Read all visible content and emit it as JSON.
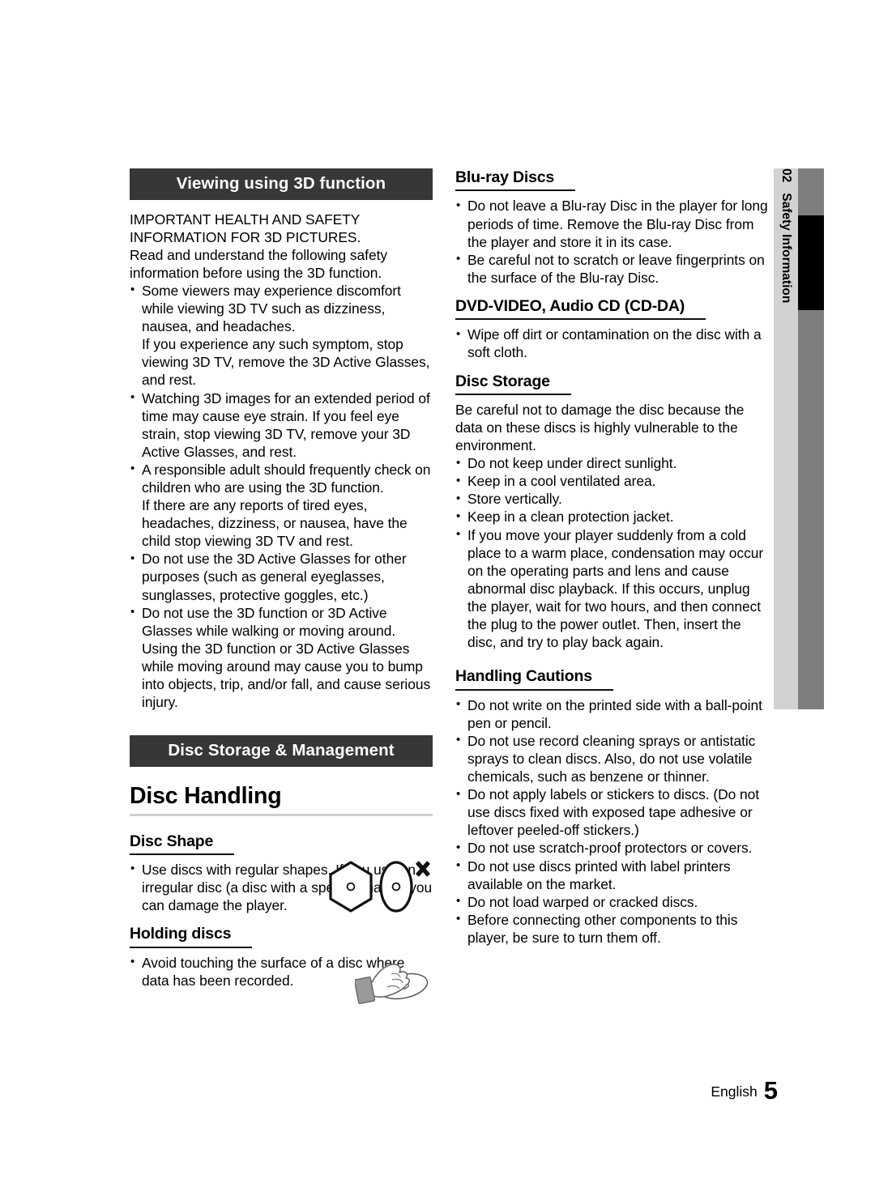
{
  "page": {
    "footer_language": "English",
    "footer_page_number": "5",
    "colors": {
      "banner_background": "#373737",
      "banner_text": "#ffffff",
      "sidetab_light": "#d2d2d2",
      "sidetab_dark": "#7e7e7e",
      "sidetab_marker": "#000000",
      "heading_rule": "#cfcfcf",
      "body_text": "#000000"
    }
  },
  "side_tab": {
    "chapter_number": "02",
    "chapter_title": "Safety Information"
  },
  "left_column": {
    "banner_3d": "Viewing using 3D function",
    "intro_line_1": "IMPORTANT HEALTH AND SAFETY INFORMATION FOR 3D PICTURES.",
    "intro_line_2": "Read and understand the following safety information before using the 3D function.",
    "bullets_3d": [
      {
        "text": "Some viewers may experience discomfort while viewing 3D TV such as dizziness, nausea, and headaches.",
        "continuation": "If you experience any such symptom, stop viewing 3D TV, remove the 3D Active Glasses, and rest."
      },
      {
        "text": "Watching 3D images for an extended period of time may cause eye strain. If you feel eye strain, stop viewing 3D TV, remove your 3D Active Glasses, and rest.",
        "continuation": ""
      },
      {
        "text": "A responsible adult should frequently check on children who are using the 3D function.",
        "continuation": "If there are any reports of tired eyes, headaches, dizziness, or nausea, have the child stop viewing 3D TV and rest."
      },
      {
        "text": "Do not use the 3D Active Glasses for other purposes (such as general eyeglasses, sunglasses, protective goggles, etc.)",
        "continuation": ""
      },
      {
        "text": "Do not use the 3D function or 3D Active Glasses while walking or moving around. Using the 3D function or 3D Active Glasses while moving around may cause you to bump into objects, trip, and/or fall, and cause serious injury.",
        "continuation": ""
      }
    ],
    "banner_storage": "Disc Storage & Management",
    "heading_disc_handling": "Disc Handling",
    "subheading_disc_shape": "Disc Shape",
    "disc_shape_bullet": "Use discs with regular shapes. If you use an irregular disc (a disc with a special shape), you can damage the player.",
    "subheading_holding_discs": "Holding discs",
    "holding_discs_bullet": "Avoid touching the surface of a disc where data has been recorded."
  },
  "right_column": {
    "subheading_bluray": "Blu-ray Discs",
    "bluray_bullets": [
      "Do not leave a Blu-ray Disc in the player for long periods of time. Remove the Blu-ray Disc from the player and store it in its case.",
      "Be careful not to scratch or leave fingerprints on the surface of the Blu-ray Disc."
    ],
    "subheading_dvd": "DVD-VIDEO, Audio CD (CD-DA)",
    "dvd_bullets": [
      "Wipe off dirt or contamination on the disc with a soft cloth."
    ],
    "subheading_disc_storage": "Disc Storage",
    "disc_storage_intro": "Be careful not to damage the disc because the data on these discs is highly vulnerable to the environment.",
    "disc_storage_bullets": [
      "Do not keep under direct sunlight.",
      "Keep in a cool ventilated area.",
      "Store vertically.",
      "Keep in a clean protection jacket.",
      "If you move your player suddenly from a cold place to a warm place, condensation may occur on the operating parts and lens and cause abnormal disc playback. If this occurs, unplug the player, wait for two hours, and then connect the plug to the power outlet. Then, insert the disc, and try to play back again."
    ],
    "subheading_handling_cautions": "Handling Cautions",
    "handling_cautions_bullets": [
      "Do not write on the printed side with a ball-point pen or pencil.",
      "Do not use record cleaning sprays or antistatic sprays to clean discs. Also, do not use volatile chemicals, such as benzene or thinner.",
      "Do not apply labels or stickers to discs. (Do not use discs fixed with exposed tape adhesive or leftover peeled-off stickers.)",
      "Do not use scratch-proof protectors or covers.",
      "Do not use discs printed with label printers available on the market.",
      "Do not load warped or cracked discs.",
      "Before connecting other components to this player, be sure to turn them off."
    ]
  }
}
